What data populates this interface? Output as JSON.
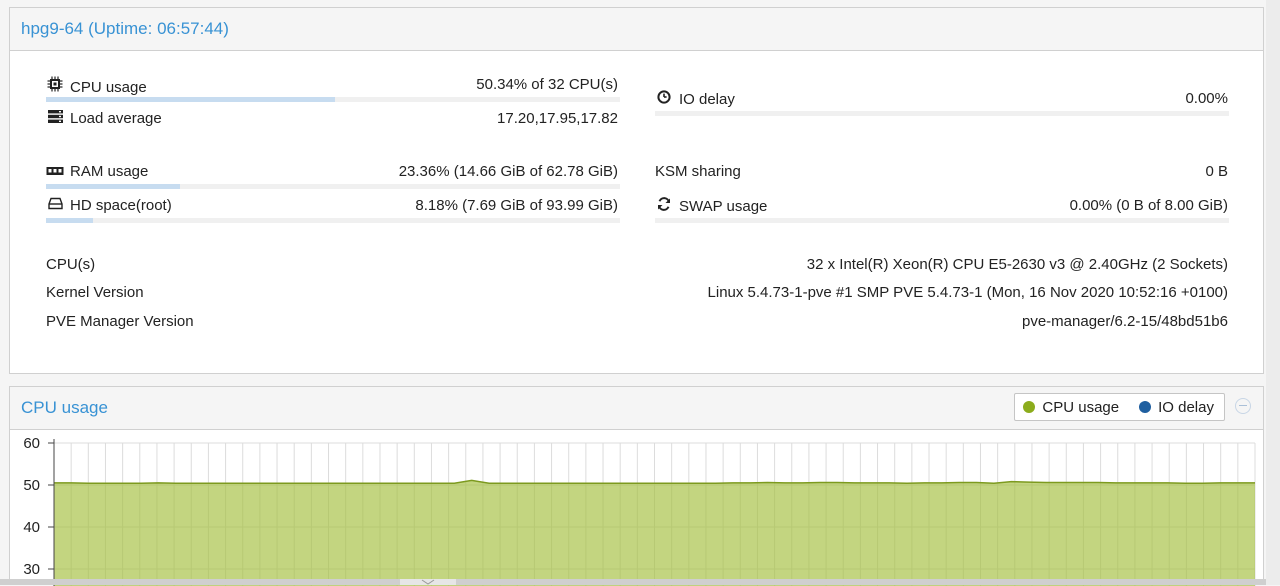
{
  "node_panel": {
    "title": "hpg9-64 (Uptime: 06:57:44)",
    "cpu": {
      "label": "CPU usage",
      "value": "50.34% of 32 CPU(s)",
      "fraction": 0.5034,
      "icon": "cpu-chip-icon"
    },
    "load": {
      "label": "Load average",
      "value": "17.20,17.95,17.82",
      "icon": "server-stack-icon"
    },
    "io": {
      "label": "IO delay",
      "value": "0.00%",
      "fraction": 0.0,
      "icon": "clock-icon"
    },
    "ram": {
      "label": "RAM usage",
      "value": "23.36% (14.66 GiB of 62.78 GiB)",
      "fraction": 0.2336,
      "icon": "memory-icon"
    },
    "hd": {
      "label": "HD space(root)",
      "value": "8.18% (7.69 GiB of 93.99 GiB)",
      "fraction": 0.0818,
      "icon": "hard-drive-icon"
    },
    "ksm": {
      "label": "KSM sharing",
      "value": "0 B"
    },
    "swap": {
      "label": "SWAP usage",
      "value": "0.00% (0 B of 8.00 GiB)",
      "fraction": 0.0,
      "icon": "refresh-icon"
    },
    "info": [
      {
        "label": "CPU(s)",
        "value": "32 x Intel(R) Xeon(R) CPU E5-2630 v3 @ 2.40GHz (2 Sockets)"
      },
      {
        "label": "Kernel Version",
        "value": "Linux 5.4.73-1-pve #1 SMP PVE 5.4.73-1 (Mon, 16 Nov 2020 10:52:16 +0100)"
      },
      {
        "label": "PVE Manager Version",
        "value": "pve-manager/6.2-15/48bd51b6"
      }
    ]
  },
  "cpu_chart_panel": {
    "title": "CPU usage",
    "legend": [
      {
        "label": "CPU usage",
        "color": "#8cac1c"
      },
      {
        "label": "IO delay",
        "color": "#1f5fa0"
      }
    ]
  },
  "chart_data": {
    "type": "area",
    "title": "CPU usage",
    "y_ticks": [
      "60",
      "50",
      "40",
      "30"
    ],
    "ylim": [
      30,
      60
    ],
    "grid": true,
    "series": [
      {
        "name": "CPU usage",
        "color": "#8cac1c",
        "values": [
          50.5,
          50.5,
          50.4,
          50.4,
          50.4,
          50.4,
          50.5,
          50.4,
          50.4,
          50.4,
          50.4,
          50.4,
          50.4,
          50.4,
          50.4,
          50.4,
          50.4,
          50.4,
          50.4,
          50.4,
          50.4,
          50.4,
          50.4,
          50.4,
          51.1,
          50.4,
          50.4,
          50.4,
          50.4,
          50.4,
          50.4,
          50.4,
          50.4,
          50.4,
          50.4,
          50.4,
          50.4,
          50.4,
          50.4,
          50.5,
          50.5,
          50.6,
          50.5,
          50.5,
          50.6,
          50.6,
          50.5,
          50.5,
          50.5,
          50.4,
          50.5,
          50.5,
          50.6,
          50.6,
          50.4,
          50.8,
          50.7,
          50.6,
          50.6,
          50.6,
          50.6,
          50.5,
          50.5,
          50.5,
          50.5,
          50.4,
          50.4,
          50.5,
          50.5,
          50.5
        ]
      },
      {
        "name": "IO delay",
        "color": "#1f5fa0",
        "values": [
          0,
          0,
          0,
          0,
          0,
          0,
          0,
          0,
          0,
          0,
          0,
          0,
          0,
          0,
          0,
          0,
          0,
          0,
          0,
          0,
          0,
          0,
          0,
          0,
          0,
          0,
          0,
          0,
          0,
          0,
          0,
          0,
          0,
          0,
          0,
          0,
          0,
          0,
          0,
          0,
          0,
          0,
          0,
          0,
          0,
          0,
          0,
          0,
          0,
          0,
          0,
          0,
          0,
          0,
          0,
          0,
          0,
          0,
          0,
          0,
          0,
          0,
          0,
          0,
          0,
          0,
          0,
          0,
          0,
          0
        ]
      }
    ]
  }
}
